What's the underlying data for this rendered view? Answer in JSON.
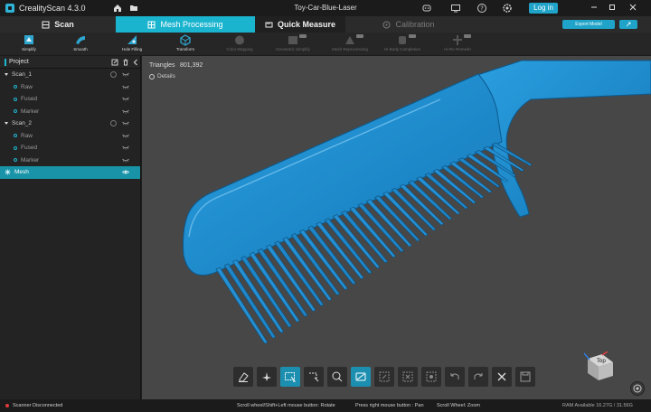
{
  "app": {
    "title": "CrealityScan 4.3.0",
    "project_title": "Toy-Car-Blue-Laser",
    "login_label": "Log in"
  },
  "modes": {
    "scan": "Scan",
    "mesh_processing": "Mesh Processing",
    "quick_measure": "Quick Measure",
    "calibration": "Calibration",
    "export_label": "Export Model"
  },
  "tools": [
    {
      "label": "Simplify"
    },
    {
      "label": "Smooth"
    },
    {
      "label": "Hole Filling"
    },
    {
      "label": "Transform"
    },
    {
      "label": "Color Mapping"
    },
    {
      "label": "Geometric Simplify"
    },
    {
      "label": "Mesh Reprocessing"
    },
    {
      "label": "Hi-Body Completion"
    },
    {
      "label": "Hi-Re Remesh"
    }
  ],
  "panel": {
    "title": "Project",
    "groups": [
      {
        "name": "Scan_1",
        "children": [
          "Raw",
          "Fused",
          "Marker"
        ]
      },
      {
        "name": "Scan_2",
        "children": [
          "Raw",
          "Fused",
          "Marker"
        ]
      }
    ],
    "selected": "Mesh"
  },
  "viewport": {
    "triangles_label": "Triangles",
    "triangles_value": "801,392",
    "details_label": "Details",
    "view_cube_label": "Top",
    "mesh_color": "#1f8fd0"
  },
  "status": {
    "scanner": "Scanner Disconnected",
    "hint_rotate": "Scroll wheel/Shift+Left mouse button: Rotate",
    "hint_pan": "Press right mouse button : Pan",
    "hint_zoom": "Scroll Wheel: Zoom",
    "ram": "RAM Available 16.27G / 31.56G"
  },
  "colors": {
    "accent": "#1bb4cf",
    "status_error": "#e23b3b"
  }
}
